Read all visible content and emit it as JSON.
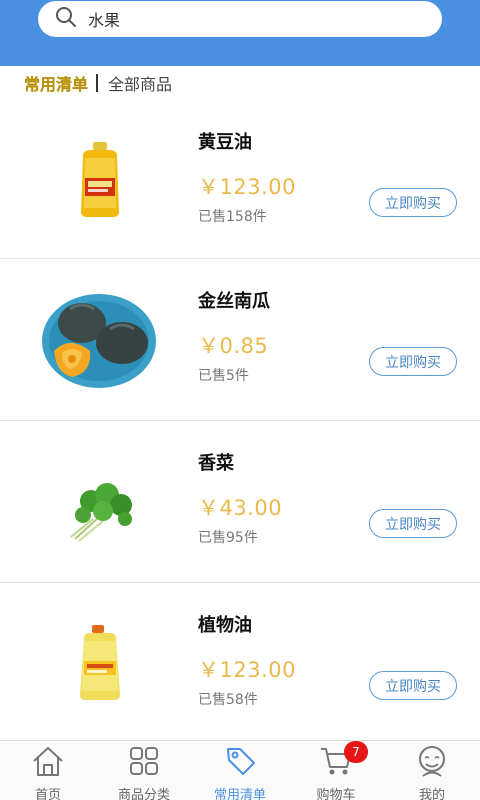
{
  "search": {
    "value": "水果",
    "icon": "search-icon"
  },
  "tabs": {
    "active": "常用清单",
    "inactive": "全部商品"
  },
  "products": [
    {
      "name": "黄豆油",
      "price": "￥123.00",
      "sold": "已售158件",
      "button": "立即购买",
      "image": "soybean-oil-bottle"
    },
    {
      "name": "金丝南瓜",
      "price": "￥0.85",
      "sold": "已售5件",
      "button": "立即购买",
      "image": "pumpkin-plate"
    },
    {
      "name": "香菜",
      "price": "￥43.00",
      "sold": "已售95件",
      "button": "立即购买",
      "image": "coriander-bunch"
    },
    {
      "name": "植物油",
      "price": "￥123.00",
      "sold": "已售58件",
      "button": "立即购买",
      "image": "vegetable-oil-bottle"
    }
  ],
  "tabbar": [
    {
      "label": "首页",
      "icon": "home-icon"
    },
    {
      "label": "商品分类",
      "icon": "grid-icon"
    },
    {
      "label": "常用清单",
      "icon": "tag-icon",
      "active": true
    },
    {
      "label": "购物车",
      "icon": "cart-icon",
      "badge": "7"
    },
    {
      "label": "我的",
      "icon": "user-icon"
    }
  ],
  "colors": {
    "header": "#4a90e2",
    "price": "#e9b94b",
    "accent": "#4a90e2",
    "badge": "#e41616"
  }
}
